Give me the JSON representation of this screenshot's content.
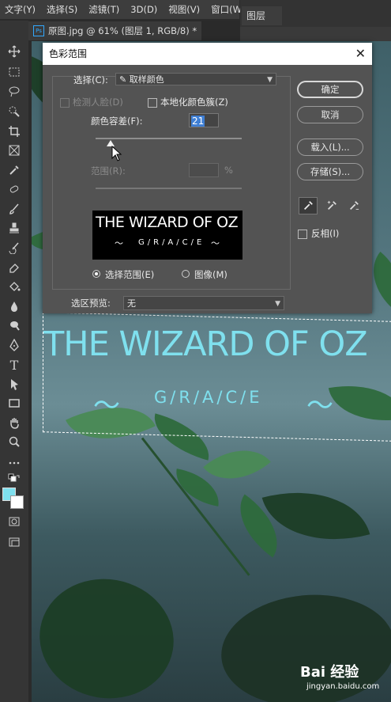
{
  "menu": {
    "items": [
      "文字(Y)",
      "选择(S)",
      "滤镜(T)",
      "3D(D)",
      "视图(V)",
      "窗口(W)"
    ]
  },
  "document_tab": {
    "ps_badge": "Ps",
    "title": "原图.jpg @ 61% (图层 1, RGB/8) *"
  },
  "right_panel": {
    "tab_label": "图层"
  },
  "canvas": {
    "title_text": "THE WIZARD OF OZ",
    "subtitle_text": "G/R/A/C/E",
    "text_color": "#7fe0ee"
  },
  "dialog": {
    "title": "色彩范围",
    "close_symbol": "✕",
    "select_label": "选择(C):",
    "select_value": "取样颜色",
    "detect_faces_label": "检测人脸(D)",
    "localized_label": "本地化颜色簇(Z)",
    "fuzziness_label": "颜色容差(F):",
    "fuzziness_value": "21",
    "fuzziness_slider_fraction": 0.1,
    "range_label": "范围(R):",
    "range_unit": "%",
    "preview_title": "THE WIZARD OF OZ",
    "preview_subtitle": "G/R/A/C/E",
    "radio_selection_label": "选择范围(E)",
    "radio_image_label": "图像(M)",
    "selection_preview_label": "选区预览:",
    "selection_preview_value": "无",
    "buttons": {
      "ok": "确定",
      "cancel": "取消",
      "load": "载入(L)...",
      "save": "存储(S)..."
    },
    "invert_label": "反相(I)"
  },
  "watermark": {
    "logo": "Bai 经验",
    "url": "jingyan.baidu.com"
  }
}
